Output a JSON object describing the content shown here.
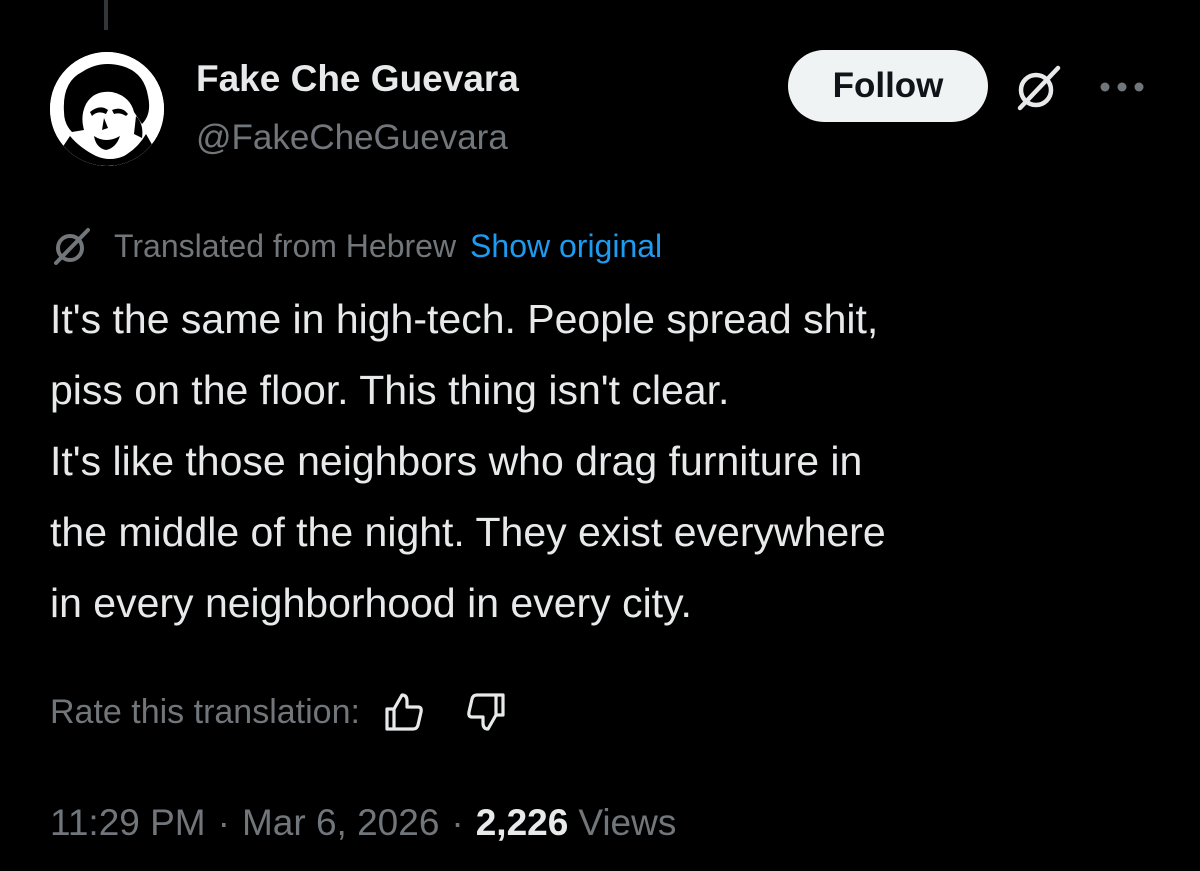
{
  "author": {
    "display_name": "Fake Che Guevara",
    "handle": "@FakeCheGuevara"
  },
  "actions": {
    "follow_label": "Follow",
    "grok_icon": "grok-icon",
    "more_icon": "more-horizontal-icon"
  },
  "translation": {
    "icon": "grok-icon",
    "label": "Translated from Hebrew",
    "show_original_label": "Show original"
  },
  "tweet": {
    "lines": [
      "It's the same in high-tech. People spread shit,",
      "piss on the floor. This thing isn't clear.",
      "It's like those neighbors who drag furniture in",
      "the middle of the night. They exist everywhere",
      "in every neighborhood in every city."
    ]
  },
  "rate": {
    "label": "Rate this translation:",
    "thumbs_up_icon": "thumbs-up-icon",
    "thumbs_down_icon": "thumbs-down-icon"
  },
  "meta": {
    "time": "11:29 PM",
    "separator": "·",
    "date": "Mar 6, 2026",
    "views_count": "2,226",
    "views_label": "Views"
  },
  "colors": {
    "background": "#000000",
    "text_primary": "#e7e9ea",
    "text_secondary": "#71767b",
    "link": "#1d9bf0",
    "follow_bg": "#eff3f4"
  }
}
